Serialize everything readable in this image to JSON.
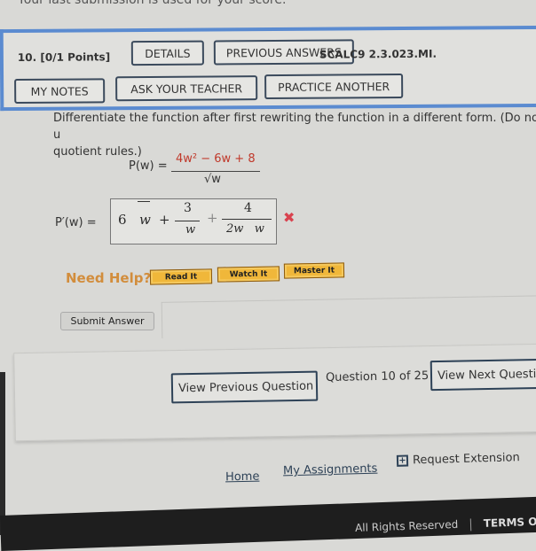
{
  "top_note": "Your last submission is used for your score.",
  "question": {
    "number_label": "10.  [0/1 Points]",
    "buttons": {
      "details": "DETAILS",
      "previous_answers": "PREVIOUS ANSWERS",
      "my_notes": "MY NOTES",
      "ask_teacher": "ASK YOUR TEACHER",
      "practice_another": "PRACTICE ANOTHER"
    },
    "code": "SCALC9 2.3.023.MI.",
    "prompt_line1": "Differentiate the function after first rewriting the function in a different form. (Do not u",
    "prompt_line2": "quotient rules.)",
    "function_label": "P(w) =",
    "numerator": "4w² − 6w + 8",
    "denominator": "√w",
    "derivative_label": "P′(w) =",
    "answer": {
      "term1_coef": "6",
      "term1_var": "w",
      "plus1": "+",
      "term2_num": "3",
      "term2_den": "w",
      "plus2": "+",
      "term3_num": "4",
      "term3_den": "2w   w"
    },
    "result_mark": "✖",
    "result": "incorrect"
  },
  "help": {
    "label": "Need Help?",
    "read_it": "Read It",
    "watch_it": "Watch It",
    "master_it": "Master It"
  },
  "submit_label": "Submit Answer",
  "navigation": {
    "previous": "View Previous Question",
    "counter": "Question 10 of 25",
    "next": "View Next Question"
  },
  "links": {
    "home": "Home",
    "my_assignments": "My Assignments",
    "request_extension": "Request Extension"
  },
  "footer": {
    "rights": "All Rights Reserved",
    "terms": "TERMS OF U"
  },
  "colors": {
    "question_border": "#5b8bd0",
    "help_button": "#f0b73a",
    "need_help_text": "#d28d3c",
    "wrong_mark": "#d9434f",
    "numerator_text": "#c0392b"
  }
}
